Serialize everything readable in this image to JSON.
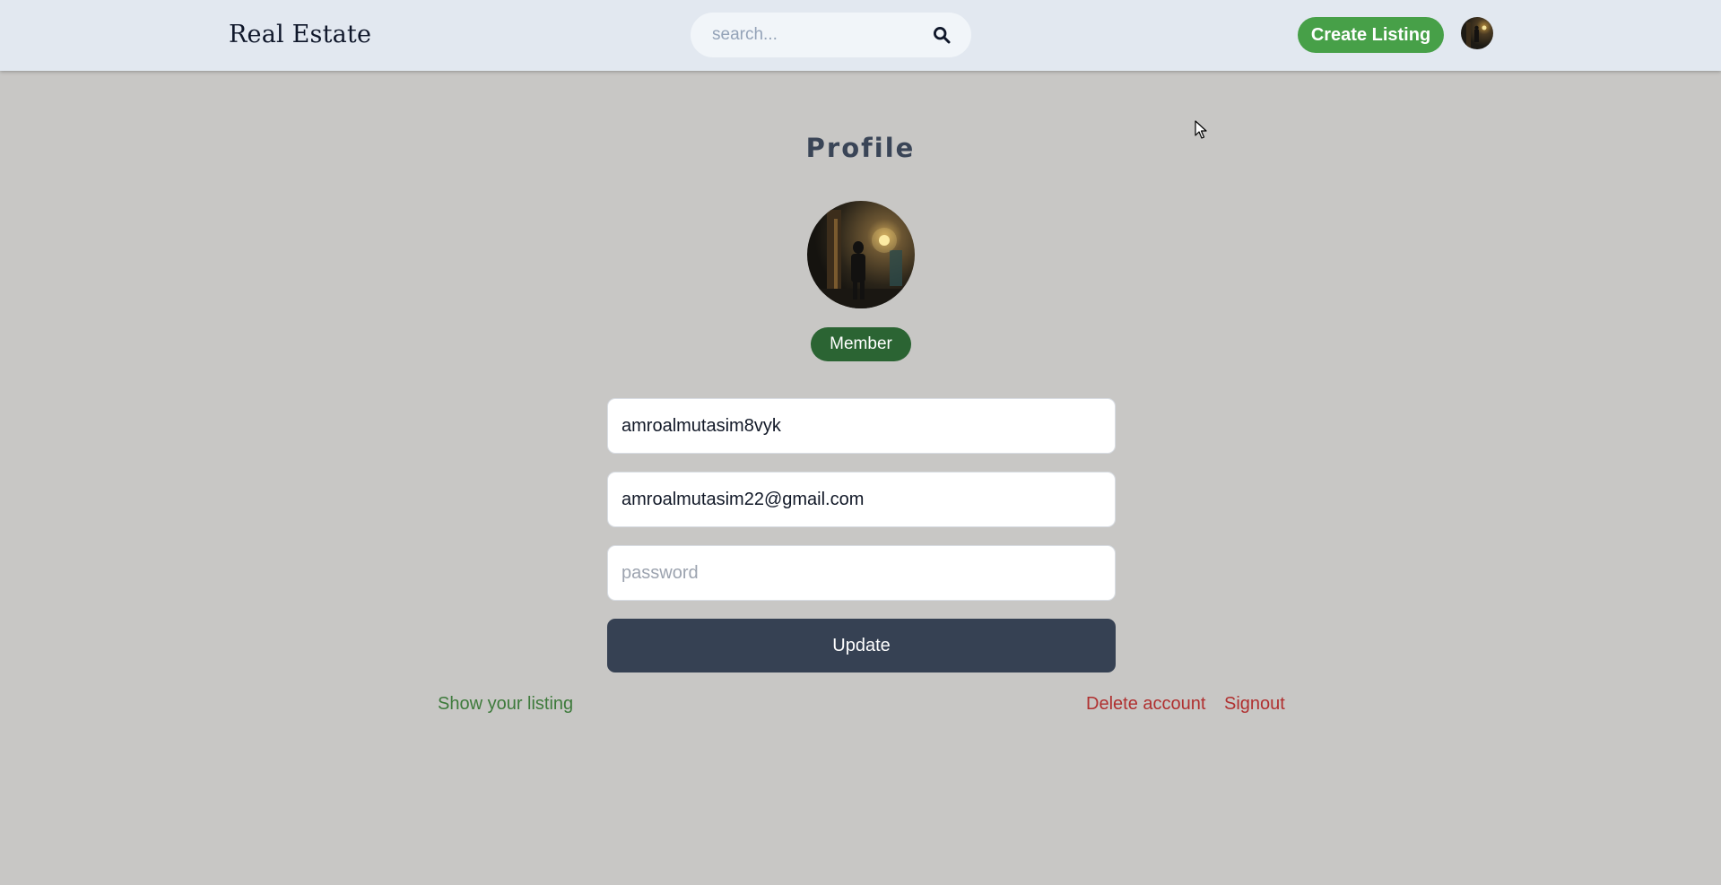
{
  "header": {
    "brand": "Real Estate",
    "search_placeholder": "search...",
    "search_icon": "search-icon",
    "create_listing_label": "Create Listing",
    "create_listing_color": "#47a048",
    "background_color": "#e2e8f0"
  },
  "profile": {
    "title": "Profile",
    "badge_label": "Member",
    "badge_color": "#2b6433",
    "username_value": "amroalmutasim8vyk",
    "email_value": "amroalmutasim22@gmail.com",
    "password_placeholder": "password",
    "update_label": "Update",
    "update_color": "#364153"
  },
  "links": {
    "show_listing": "Show your listing",
    "delete_account": "Delete account",
    "signout": "Signout"
  },
  "colors": {
    "page_background": "#c8c7c5",
    "link_green": "#3d7a3b",
    "link_red": "#b03030"
  }
}
